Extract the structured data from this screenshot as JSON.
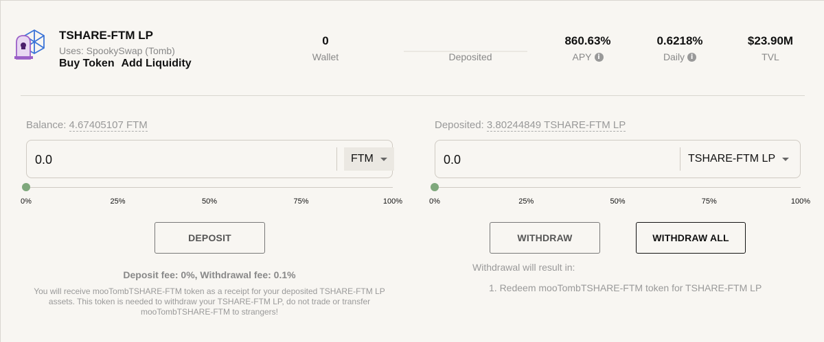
{
  "vault": {
    "name": "TSHARE-FTM LP",
    "platform": "Uses: SpookySwap (Tomb)",
    "buy_token": "Buy Token",
    "add_liquidity": "Add Liquidity"
  },
  "stats": {
    "wallet": {
      "value": "0",
      "label": "Wallet"
    },
    "deposited": {
      "value": "",
      "label": "Deposited"
    },
    "apy": {
      "value": "860.63%",
      "label": "APY"
    },
    "daily": {
      "value": "0.6218%",
      "label": "Daily"
    },
    "tvl": {
      "value": "$23.90M",
      "label": "TVL"
    }
  },
  "deposit_panel": {
    "balance_prefix": "Balance:",
    "balance_amount": "4.67405107 FTM",
    "input_value": "0.0",
    "token": "FTM",
    "slider_percent": 0,
    "slider_labels": [
      "0%",
      "25%",
      "50%",
      "75%",
      "100%"
    ],
    "button": "DEPOSIT",
    "fee_text": "Deposit fee: 0%, Withdrawal fee: 0.1%",
    "receipt_note": "You will receive mooTombTSHARE-FTM token as a receipt for your deposited TSHARE-FTM LP assets. This token is needed to withdraw your TSHARE-FTM LP, do not trade or transfer mooTombTSHARE-FTM to strangers!"
  },
  "withdraw_panel": {
    "deposited_prefix": "Deposited:",
    "deposited_amount": "3.80244849 TSHARE-FTM LP",
    "input_value": "0.0",
    "token": "TSHARE-FTM LP",
    "slider_percent": 0,
    "slider_labels": [
      "0%",
      "25%",
      "50%",
      "75%",
      "100%"
    ],
    "withdraw_button": "WITHDRAW",
    "withdraw_all_button": "WITHDRAW ALL",
    "result_title": "Withdrawal will result in:",
    "result_step": "1. Redeem mooTombTSHARE-FTM token for TSHARE-FTM LP"
  },
  "colors": {
    "background": "#f8f6f2",
    "slider_knob": "#7fa87c",
    "logo_purple": "#9b5fc7",
    "logo_blue": "#3b74d8"
  }
}
